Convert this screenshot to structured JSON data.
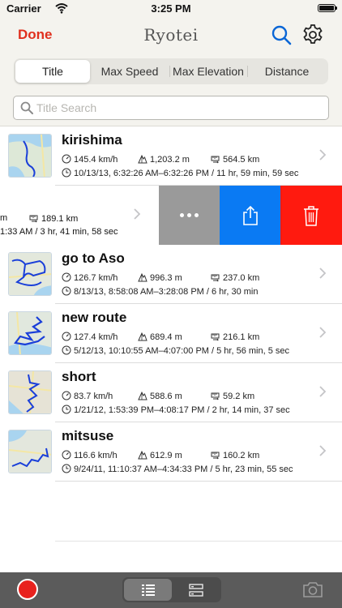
{
  "status": {
    "carrier": "Carrier",
    "time": "3:25 PM"
  },
  "nav": {
    "done": "Done",
    "title": "Ryotei",
    "search_icon": "search-icon",
    "settings_icon": "gear-icon"
  },
  "sort_tabs": [
    {
      "label": "Title",
      "selected": true
    },
    {
      "label": "Max Speed",
      "selected": false
    },
    {
      "label": "Max Elevation",
      "selected": false
    },
    {
      "label": "Distance",
      "selected": false
    }
  ],
  "search": {
    "placeholder": "Title Search",
    "value": ""
  },
  "routes": [
    {
      "name": "kirishima",
      "speed": "145.4 km/h",
      "elevation": "1,203.2 m",
      "distance": "564.5 km",
      "date": "10/13/13, 6:32:26 AM–6:32:26 PM / 11 hr, 59 min, 59 sec"
    },
    {
      "name": "",
      "speed": "",
      "elevation": "m",
      "distance": "189.1 km",
      "date": "1:33 AM / 3 hr, 41 min, 58 sec",
      "swiped": true
    },
    {
      "name": "go to Aso",
      "speed": "126.7 km/h",
      "elevation": "996.3 m",
      "distance": "237.0 km",
      "date": "8/13/13, 8:58:08 AM–3:28:08 PM / 6 hr, 30 min"
    },
    {
      "name": "new route",
      "speed": "127.4 km/h",
      "elevation": "689.4 m",
      "distance": "216.1 km",
      "date": "5/12/13, 10:10:55 AM–4:07:00 PM / 5 hr, 56 min, 5 sec"
    },
    {
      "name": "short",
      "speed": "83.7 km/h",
      "elevation": "588.6 m",
      "distance": "59.2 km",
      "date": "1/21/12, 1:53:39 PM–4:08:17 PM / 2 hr, 14 min, 37 sec"
    },
    {
      "name": "mitsuse",
      "speed": "116.6 km/h",
      "elevation": "612.9 m",
      "distance": "160.2 km",
      "date": "9/24/11, 11:10:37 AM–4:34:33 PM / 5 hr, 23 min, 55 sec"
    }
  ],
  "swipe_actions": [
    "more-icon",
    "share-icon",
    "trash-icon"
  ],
  "toolbar": {
    "record_icon": "record-icon",
    "camera_icon": "camera-icon",
    "view_modes": [
      "list-icon",
      "detail-list-icon"
    ]
  }
}
